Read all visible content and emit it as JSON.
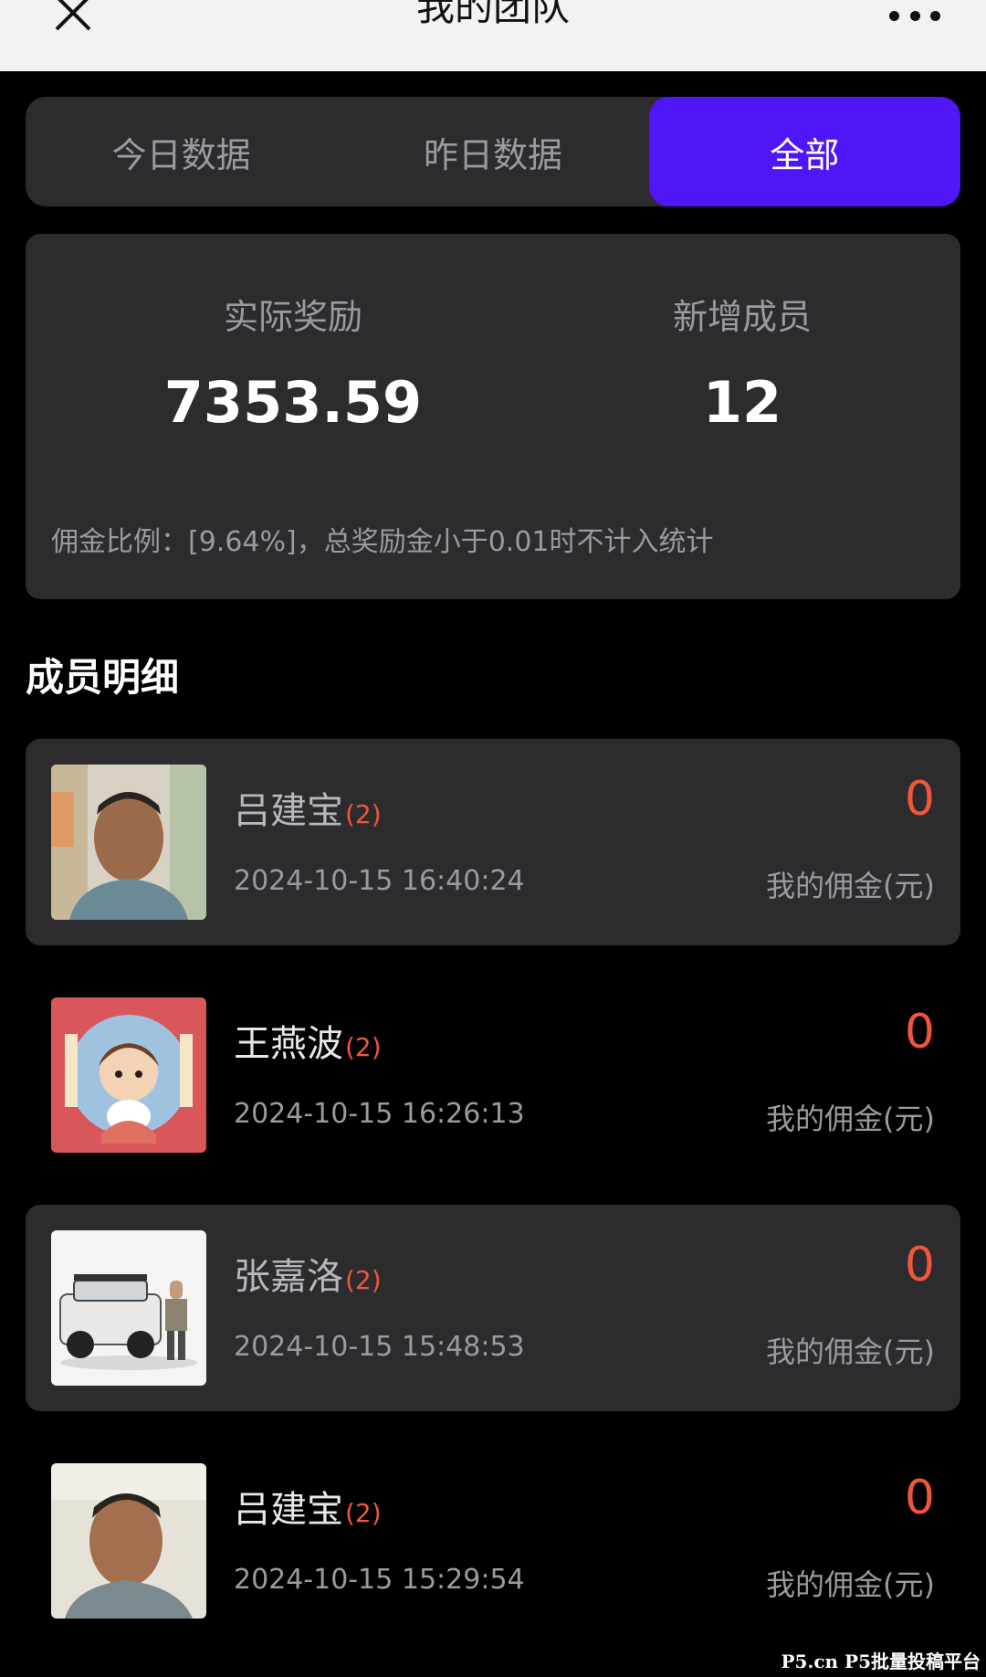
{
  "nav": {
    "title": "我的团队",
    "close_icon": "close-icon",
    "more_icon": "more-icon"
  },
  "tabs": [
    {
      "label": "今日数据",
      "active": false
    },
    {
      "label": "昨日数据",
      "active": false
    },
    {
      "label": "全部",
      "active": true
    }
  ],
  "summary": {
    "reward_label": "实际奖励",
    "reward_value": "7353.59",
    "new_members_label": "新增成员",
    "new_members_value": "12",
    "note": "佣金比例：[9.64%]，总奖励金小于0.01时不计入统计"
  },
  "section_title": "成员明细",
  "members": [
    {
      "name": "吕建宝",
      "count": "(2)",
      "time": "2024-10-15 16:40:24",
      "amount": "0",
      "amount_label": "我的佣金(元)"
    },
    {
      "name": "王燕波",
      "count": "(2)",
      "time": "2024-10-15 16:26:13",
      "amount": "0",
      "amount_label": "我的佣金(元)"
    },
    {
      "name": "张嘉洛",
      "count": "(2)",
      "time": "2024-10-15 15:48:53",
      "amount": "0",
      "amount_label": "我的佣金(元)"
    },
    {
      "name": "吕建宝",
      "count": "(2)",
      "time": "2024-10-15 15:29:54",
      "amount": "0",
      "amount_label": "我的佣金(元)"
    }
  ],
  "watermark": "P5.cn P5批量投稿平台",
  "colors": {
    "accent": "#4f17f7",
    "card": "#2c2c2e",
    "amount": "#f0563b"
  }
}
